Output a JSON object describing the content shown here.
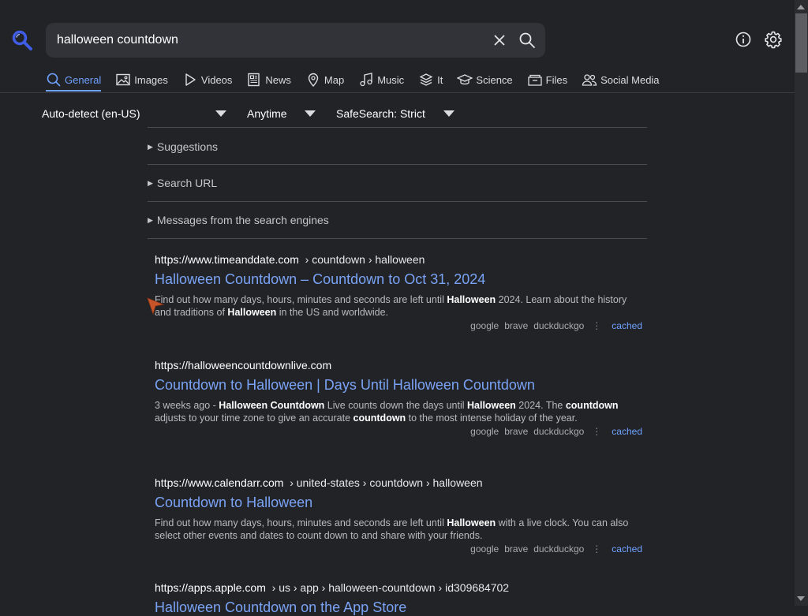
{
  "search": {
    "query": "halloween countdown"
  },
  "tabs": [
    {
      "label": "General",
      "icon": "search-icon",
      "active": true
    },
    {
      "label": "Images",
      "icon": "image-icon"
    },
    {
      "label": "Videos",
      "icon": "play-icon"
    },
    {
      "label": "News",
      "icon": "newspaper-icon"
    },
    {
      "label": "Map",
      "icon": "map-pin-icon"
    },
    {
      "label": "Music",
      "icon": "music-note-icon"
    },
    {
      "label": "It",
      "icon": "layers-icon"
    },
    {
      "label": "Science",
      "icon": "graduation-cap-icon"
    },
    {
      "label": "Files",
      "icon": "archive-icon"
    },
    {
      "label": "Social Media",
      "icon": "people-icon"
    }
  ],
  "filters": {
    "language": "Auto-detect (en-US)",
    "time": "Anytime",
    "safesearch": "SafeSearch: Strict"
  },
  "sections": {
    "suggestions": "Suggestions",
    "search_url": "Search URL",
    "messages": "Messages from the search engines"
  },
  "results": [
    {
      "domain": "https://www.timeanddate.com",
      "path": "› countdown › halloween",
      "title": "Halloween Countdown – Countdown to Oct 31, 2024",
      "snippet": [
        {
          "t": "Find out how many days, hours, minutes and seconds are left until "
        },
        {
          "t": "Halloween",
          "b": true
        },
        {
          "t": " 2024. Learn about the history and traditions of "
        },
        {
          "t": "Halloween",
          "b": true
        },
        {
          "t": " in the US and worldwide."
        }
      ],
      "engines": [
        "google",
        "brave",
        "duckduckgo"
      ],
      "cached": "cached"
    },
    {
      "domain": "https://halloweencountdownlive.com",
      "path": "",
      "title": "Countdown to Halloween | Days Until Halloween Countdown",
      "snippet": [
        {
          "t": "3 weeks ago - "
        },
        {
          "t": "Halloween Countdown",
          "b": true
        },
        {
          "t": " Live counts down the days until "
        },
        {
          "t": "Halloween",
          "b": true
        },
        {
          "t": " 2024. The "
        },
        {
          "t": "countdown",
          "b": true
        },
        {
          "t": " adjusts to your time zone to give an accurate "
        },
        {
          "t": "countdown",
          "b": true
        },
        {
          "t": " to the most intense holiday of the year."
        }
      ],
      "engines": [
        "google",
        "brave",
        "duckduckgo"
      ],
      "cached": "cached"
    },
    {
      "domain": "https://www.calendarr.com",
      "path": "› united-states › countdown › halloween",
      "title": "Countdown to Halloween",
      "snippet": [
        {
          "t": "Find out how many days, hours, minutes and seconds are left until "
        },
        {
          "t": "Halloween",
          "b": true
        },
        {
          "t": " with a live clock. You can also select other events and dates to count down to and share with your friends."
        }
      ],
      "engines": [
        "google",
        "brave",
        "duckduckgo"
      ],
      "cached": "cached"
    },
    {
      "domain": "https://apps.apple.com",
      "path": "› us › app › halloween-countdown › id309684702",
      "title": "Halloween Countdown on the App Store",
      "snippet": [],
      "engines": [],
      "cached": ""
    }
  ],
  "colors": {
    "background": "#222327",
    "accent": "#6fa1ff",
    "link": "#7aa3f5",
    "logo": "#3f5de6"
  }
}
